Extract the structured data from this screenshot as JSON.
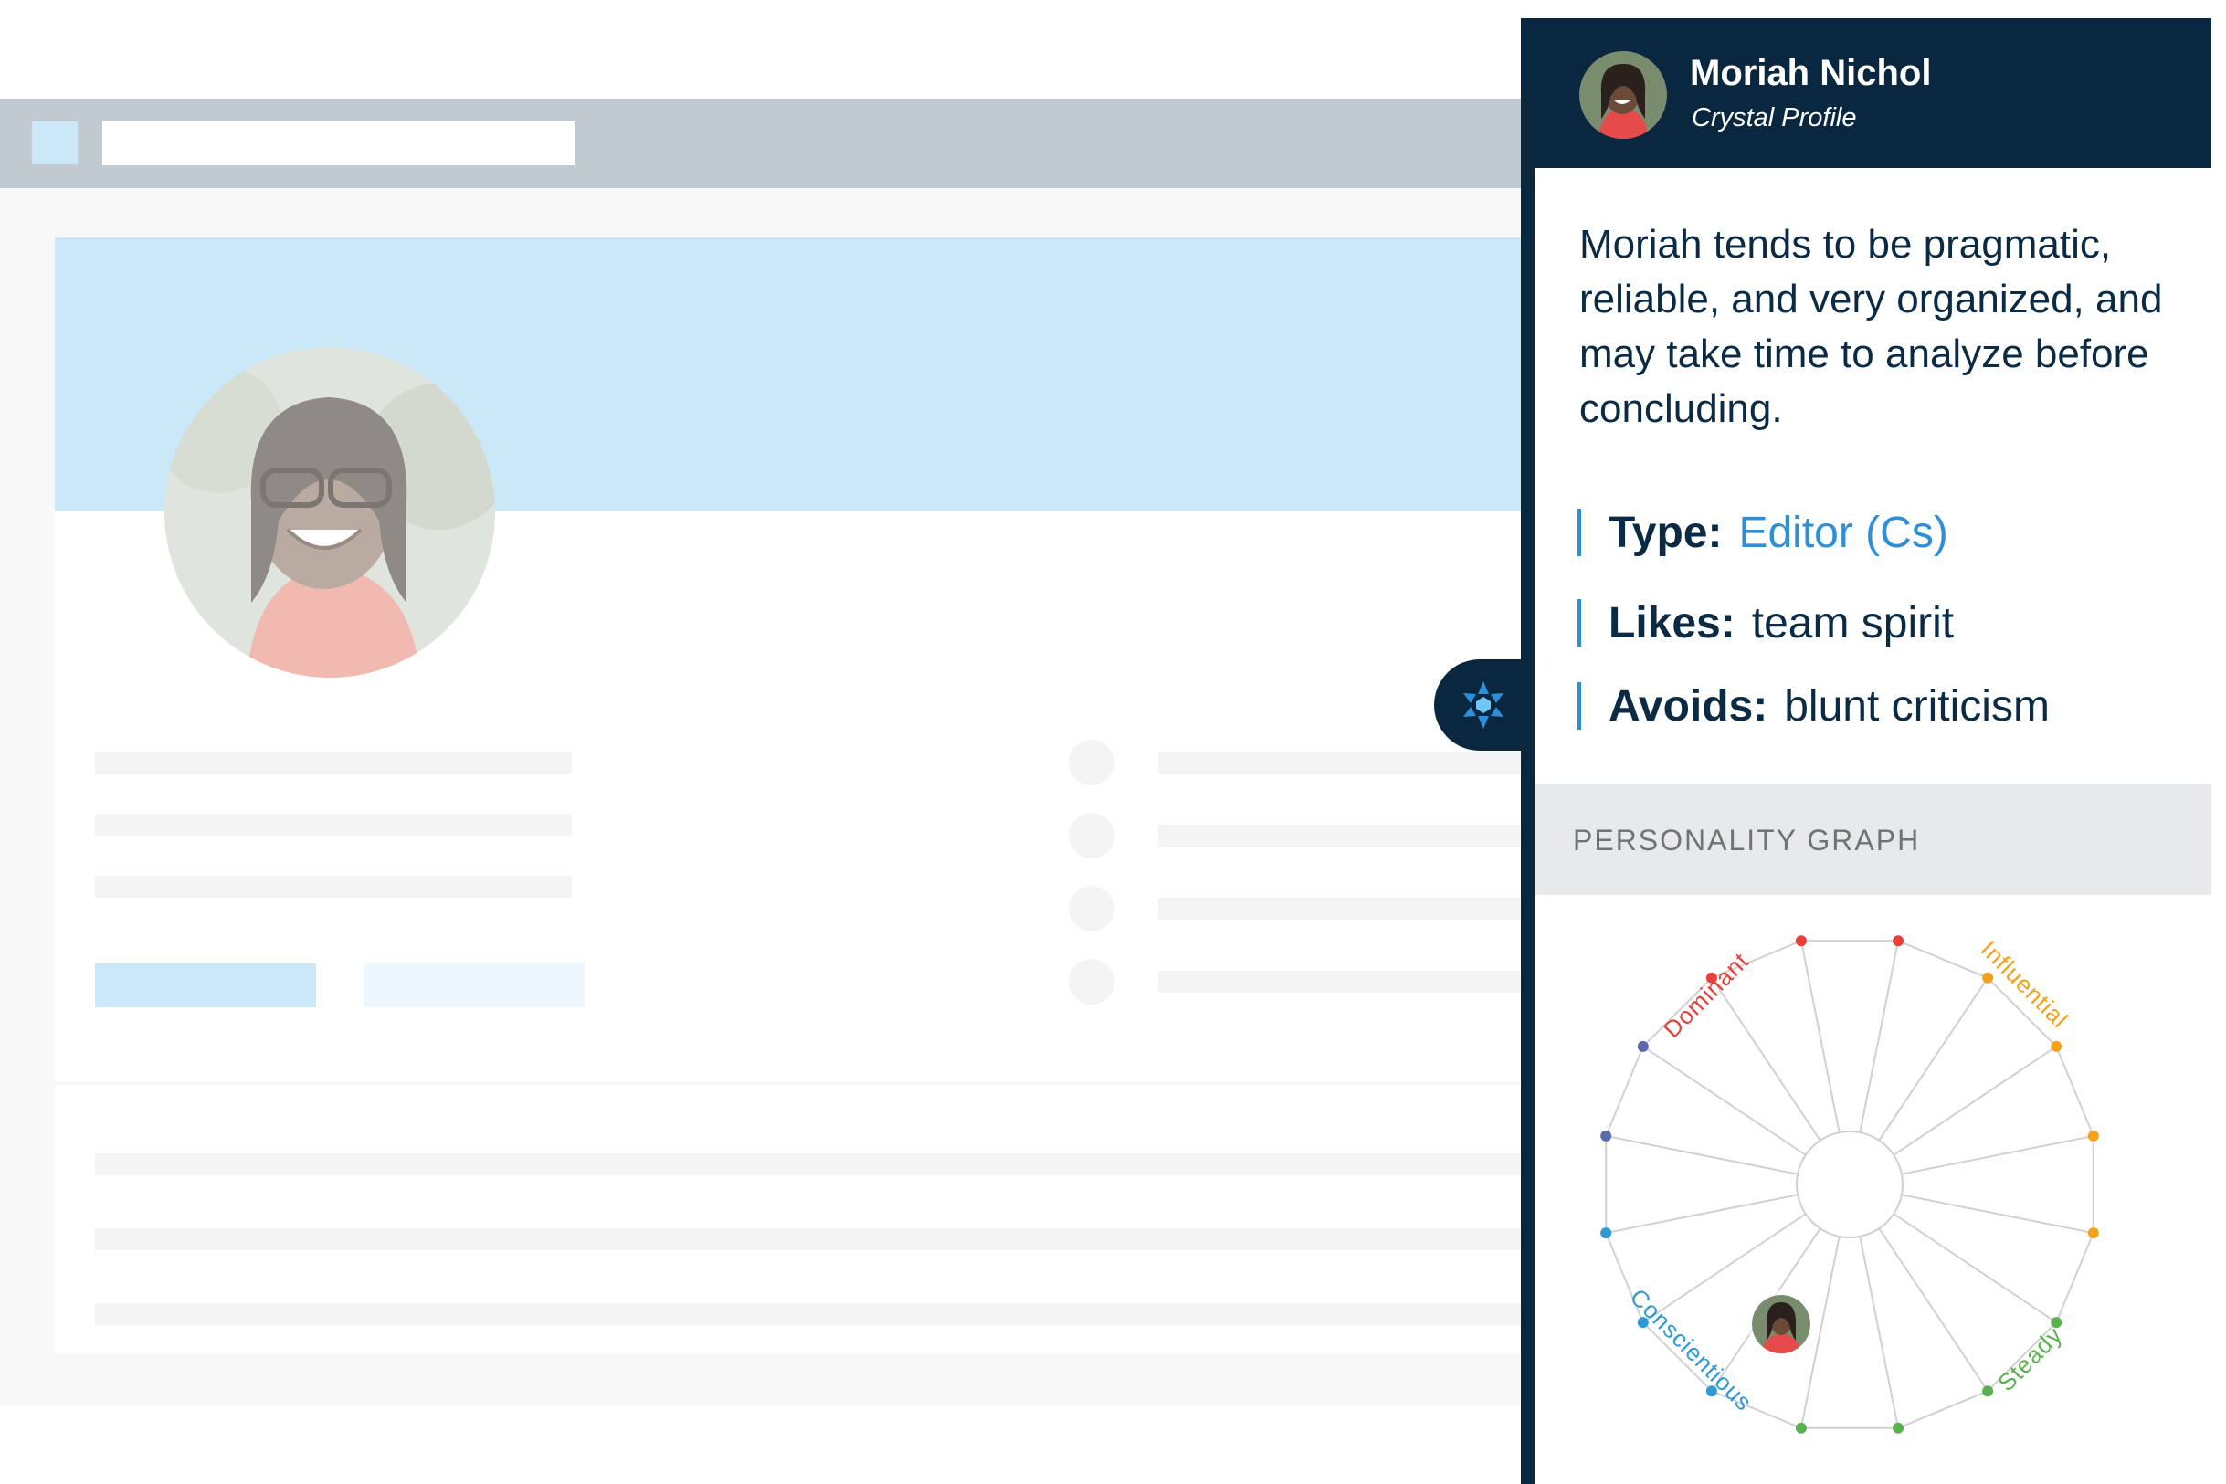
{
  "panel": {
    "name": "Moriah Nichol",
    "subtitle": "Crystal Profile",
    "summary": "Moriah tends to be pragmatic, reliable, and very organized, and may take time to analyze before concluding.",
    "attributes": [
      {
        "label": "Type:",
        "value": "Editor (Cs)"
      },
      {
        "label": "Likes:",
        "value": "team spirit"
      },
      {
        "label": "Avoids:",
        "value": "blunt criticism"
      }
    ],
    "graph_title": "PERSONALITY GRAPH",
    "graph_labels": {
      "dominant": "Dominant",
      "influential": "Influential",
      "steady": "Steady",
      "conscientious": "Conscientious"
    }
  },
  "colors": {
    "navy": "#0a2740",
    "accent_blue": "#2f8fd6",
    "dominant": "#e8413c",
    "influential": "#f3a21a",
    "steady": "#5ab24e",
    "conscientious": "#2e9bd6"
  },
  "icons": {
    "crystal_tab": "crystal-snowflake-icon"
  }
}
